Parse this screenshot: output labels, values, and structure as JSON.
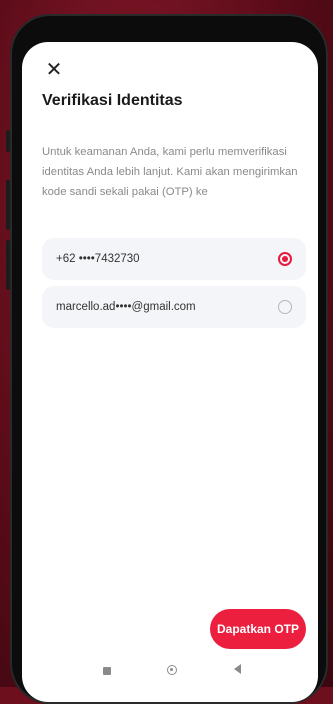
{
  "header": {
    "close_icon": "close-icon",
    "title": "Verifikasi Identitas"
  },
  "description": "Untuk keamanan Anda, kami perlu memverifikasi identitas Anda lebih lanjut. Kami akan mengirimkan kode sandi sekali pakai (OTP) ke",
  "options": [
    {
      "label": "+62 ••••7432730",
      "selected": true
    },
    {
      "label": "marcello.ad••••@gmail.com",
      "selected": false
    }
  ],
  "cta": {
    "label": "Dapatkan OTP"
  },
  "colors": {
    "accent": "#ec1f3f",
    "background": "#6e0f1e"
  },
  "nav": {
    "icons": [
      "recents-icon",
      "home-icon",
      "back-icon"
    ]
  }
}
